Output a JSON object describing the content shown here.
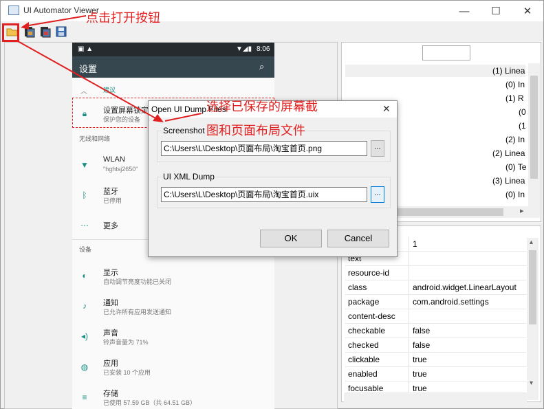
{
  "window": {
    "title": "UI Automator Viewer",
    "minimize": "—",
    "maximize": "☐",
    "close": "✕"
  },
  "toolbar": {
    "open": "open-folder",
    "screenshot": "device-screenshot",
    "screenshot2": "device-screenshot-compressed",
    "save": "save"
  },
  "annotations": {
    "click_open": "点击打开按钮",
    "select_files_1": "选择已保存的屏幕截",
    "select_files_2": "图和页面布局文件"
  },
  "phone": {
    "status_time": "8:06",
    "appbar_title": "设置",
    "suggest": "建议",
    "row_lock_title": "设置屏幕锁定",
    "row_lock_sub": "保护您的设备",
    "section_wireless": "无线和网络",
    "wlan_title": "WLAN",
    "wlan_sub": "\"hghtsj2650\"",
    "bt_title": "蓝牙",
    "bt_sub": "已停用",
    "more_title": "更多",
    "section_device": "设备",
    "display_title": "显示",
    "display_sub": "自动调节亮度功能已关闭",
    "notif_title": "通知",
    "notif_sub": "已允许所有应用发送通知",
    "sound_title": "声音",
    "sound_sub": "铃声音量为 71%",
    "apps_title": "应用",
    "apps_sub": "已安装 10 个应用",
    "storage_title": "存储",
    "storage_sub": "已使用 57.59 GB（共 64.51 GB）"
  },
  "dialog": {
    "title": "Open UI Dump Files",
    "close": "✕",
    "screenshot_label": "Screenshot",
    "screenshot_value": "C:\\Users\\L\\Desktop\\页面布局\\淘宝首页.png",
    "xml_label": "UI XML Dump",
    "xml_value": "C:\\Users\\L\\Desktop\\页面布局\\淘宝首页.uix",
    "browse": "...",
    "ok": "OK",
    "cancel": "Cancel"
  },
  "tree": {
    "items": [
      "(1) Linea",
      "(0) In",
      "(1) R",
      "(0",
      "(1",
      "(2) In",
      "(2) Linea",
      "(0) Te",
      "(3) Linea",
      "(0) In"
    ]
  },
  "props": {
    "rows": [
      {
        "k": "",
        "v": "1"
      },
      {
        "k": "text",
        "v": ""
      },
      {
        "k": "resource-id",
        "v": ""
      },
      {
        "k": "class",
        "v": "android.widget.LinearLayout"
      },
      {
        "k": "package",
        "v": "com.android.settings"
      },
      {
        "k": "content-desc",
        "v": ""
      },
      {
        "k": "checkable",
        "v": "false"
      },
      {
        "k": "checked",
        "v": "false"
      },
      {
        "k": "clickable",
        "v": "true"
      },
      {
        "k": "enabled",
        "v": "true"
      },
      {
        "k": "focusable",
        "v": "true"
      }
    ]
  },
  "colors": {
    "accent": "#e02020",
    "appbar": "#37474f",
    "teal": "#1a8f84"
  }
}
